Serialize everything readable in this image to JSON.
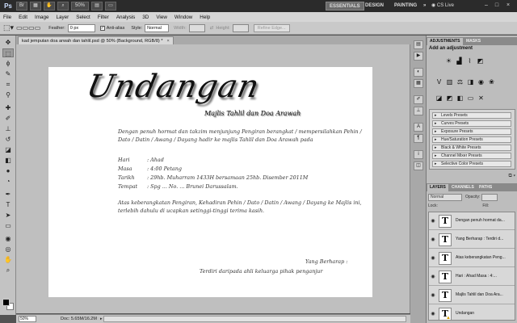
{
  "app": {
    "logo": "Ps",
    "workspaces": [
      "ESSENTIALS",
      "DESIGN",
      "PAINTING",
      "»"
    ],
    "cs_live": "CS Live",
    "zoom_display": "50%"
  },
  "menu": [
    "File",
    "Edit",
    "Image",
    "Layer",
    "Select",
    "Filter",
    "Analysis",
    "3D",
    "View",
    "Window",
    "Help"
  ],
  "options": {
    "feather_label": "Feather:",
    "feather_value": "0 px",
    "antialias_label": "Anti-alias",
    "style_label": "Style:",
    "style_value": "Normal",
    "width_label": "Width:",
    "height_label": "Height:",
    "refine_label": "Refine Edge..."
  },
  "document": {
    "tab_title": "kad jemputan doa arwah dan tahlil.psd @ 50% (Background, RGB/8) *",
    "close": "×"
  },
  "card": {
    "title": "Undangan",
    "subtitle": "Majlis Tahlil dan Doa Arawah",
    "intro": "Dengan penuh hormat dan takzim menjunjung Pengiran berangkat / mempersilahkan Pehin / Dato / Datin / Awang / Dayang hadir ke majlis Tahlil dan Doa Arawah pada",
    "details": [
      {
        "key": "Hari",
        "value": ": Ahad"
      },
      {
        "key": "Masa",
        "value": ": 4:00 Petang"
      },
      {
        "key": "Tarikh",
        "value": ": 29hb. Muharram 1433H bersamaan 25hb. Disember 2011M"
      },
      {
        "key": "Tempat",
        "value": ": Spg ... No. ...  Brunei Darussalam."
      }
    ],
    "closing": "Atas keberangkatan Pengiran, Kehadiran Pehin / Dato / Datin / Awang / Dayang ke Majlis ini, terlebih dahulu di ucapkan setinggi-tinggi terima kasih.",
    "regards": "Yang Berharap :",
    "from": "Terdiri daripada ahli keluarga pihak penganjur"
  },
  "status": {
    "zoom": "50%",
    "doc": "Doc: 5.65M/16.2M",
    "arrow": "▸"
  },
  "panels": {
    "adjust_tabs": [
      "ADJUSTMENTS",
      "MASKS"
    ],
    "adjust_title": "Add an adjustment",
    "presets": [
      "Levels Presets",
      "Curves Presets",
      "Exposure Presets",
      "Hue/Saturation Presets",
      "Black & White Presets",
      "Channel Mixer Presets",
      "Selective Color Presets"
    ],
    "layer_tabs": [
      "LAYERS",
      "CHANNELS",
      "PATHS"
    ],
    "blend_mode": "Normal",
    "opacity_label": "Opacity:",
    "fill_label": "Fill:",
    "lock_label": "Lock:",
    "layers": [
      {
        "name": "Dengan penuh hormat da..."
      },
      {
        "name": "Yang Berharap : Terdiri d..."
      },
      {
        "name": "Atas keberangkatan Peng..."
      },
      {
        "name": "Hari   : Ahad Masa   : 4:..."
      },
      {
        "name": "Majlis Tahlil dan Doa Ara..."
      },
      {
        "name": "Undangan"
      }
    ],
    "thumb_glyph": "T"
  }
}
